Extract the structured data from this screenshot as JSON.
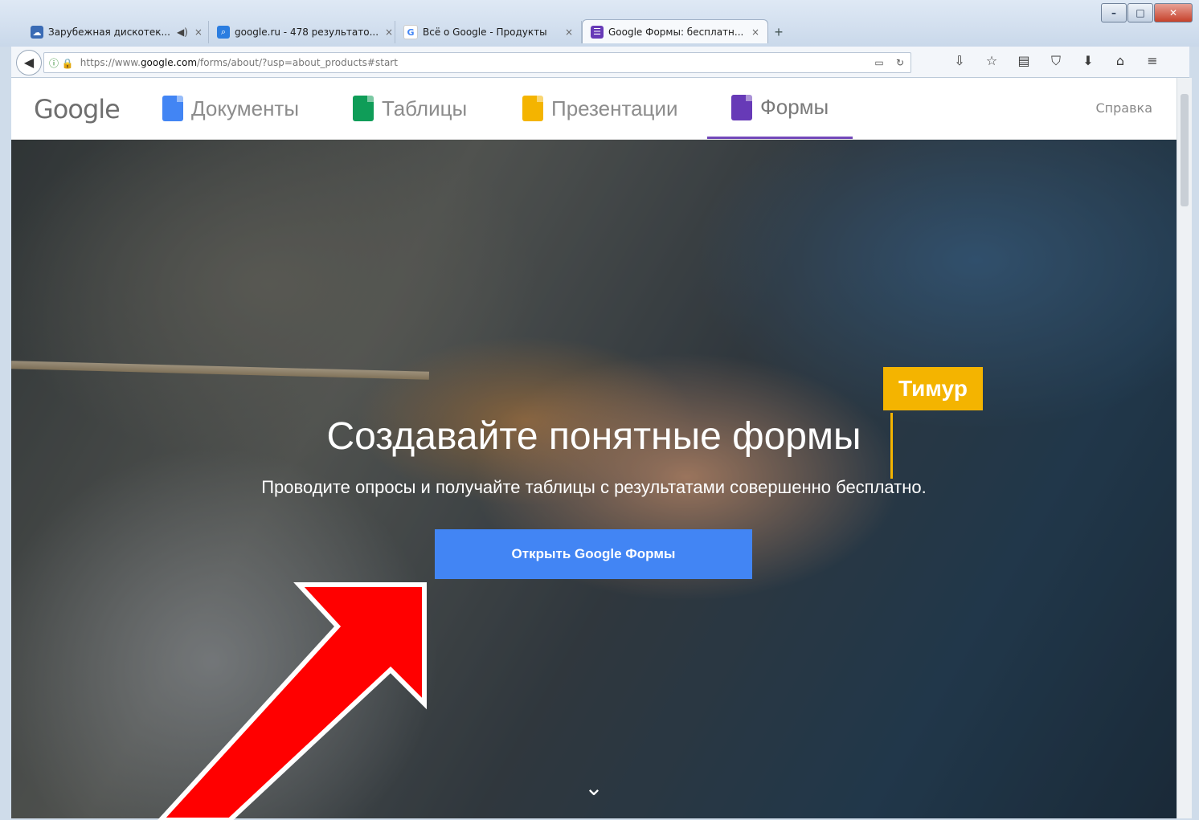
{
  "window": {
    "controls": [
      "–",
      "□",
      "✕"
    ]
  },
  "tabs": [
    {
      "label": "Зарубежная дискотек...",
      "icon": "cloud-icon",
      "icon_color": "#3a6bb5",
      "audio": "◀)"
    },
    {
      "label": "google.ru - 478 результато...",
      "icon": "search-icon",
      "icon_color": "#2b7de0"
    },
    {
      "label": "Всё о Google - Продукты",
      "icon": "google-g-icon",
      "icon_color": "#ffffff"
    },
    {
      "label": "Google Формы: бесплатн...",
      "icon": "forms-icon",
      "icon_color": "#673ab7"
    }
  ],
  "new_tab": "+",
  "tab_close": "×",
  "url": {
    "prefix": "https://www.",
    "host": "google.com",
    "path": "/forms/about/?usp=about_products#start"
  },
  "nav_icons": [
    "reader-icon",
    "reload-icon",
    "download-icon",
    "dropdown-icon",
    "bookmark-star-icon",
    "bookmarks-list-icon",
    "pocket-icon",
    "downloads-icon",
    "home-icon",
    "menu-icon"
  ],
  "header": {
    "logo": "Google",
    "products": [
      {
        "label": "Документы",
        "color": "#4285f4"
      },
      {
        "label": "Таблицы",
        "color": "#0f9d58"
      },
      {
        "label": "Презентации",
        "color": "#f4b400"
      },
      {
        "label": "Формы",
        "color": "#673ab7"
      }
    ],
    "help": "Справка"
  },
  "hero": {
    "headline": "Создавайте понятные формы",
    "subtitle": "Проводите опросы и получайте таблицы с результатами совершенно бесплатно.",
    "cta": "Открыть Google Формы",
    "scroll_hint": "⌄",
    "cursor_name": "Тимур"
  },
  "colors": {
    "cta": "#4285f4",
    "accent": "#f4b400",
    "arrow": "#ff0000",
    "forms_purple": "#673ab7"
  }
}
